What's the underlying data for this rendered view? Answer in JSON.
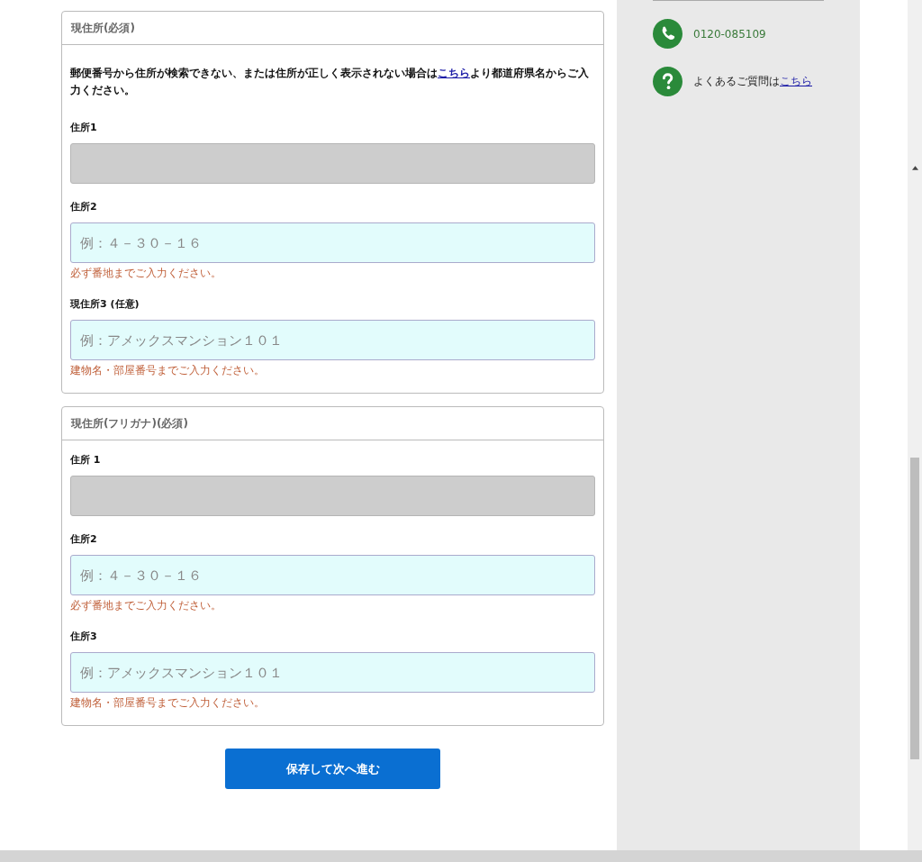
{
  "sections": [
    {
      "title": "現住所(必須)",
      "note": {
        "before": "郵便番号から住所が検索できない、または住所が正しく表示されない場合は",
        "link": "こちら",
        "after": "より都道府県名からご入力ください。"
      },
      "fields": [
        {
          "label": "住所1",
          "kind": "disabled"
        },
        {
          "label": "住所2",
          "kind": "input",
          "placeholder": "例：４－３０－１６",
          "hint": "必ず番地までご入力ください。"
        },
        {
          "label": "現住所3 (任意)",
          "kind": "input",
          "placeholder": "例：アメックスマンション１０１",
          "hint": "建物名・部屋番号までご入力ください。"
        }
      ]
    },
    {
      "title": "現住所(フリガナ)(必須)",
      "fields": [
        {
          "label": "住所 1",
          "kind": "disabled"
        },
        {
          "label": "住所2",
          "kind": "input",
          "placeholder": "例：４－３０－１６",
          "hint": "必ず番地までご入力ください。"
        },
        {
          "label": "住所3",
          "kind": "input",
          "placeholder": "例：アメックスマンション１０１",
          "hint": "建物名・部屋番号までご入力ください。"
        }
      ]
    }
  ],
  "submit": "保存して次へ進む",
  "sidebar": {
    "phone": "0120-085109",
    "faq": {
      "text": "よくあるご質問は",
      "link": "こちら"
    }
  }
}
